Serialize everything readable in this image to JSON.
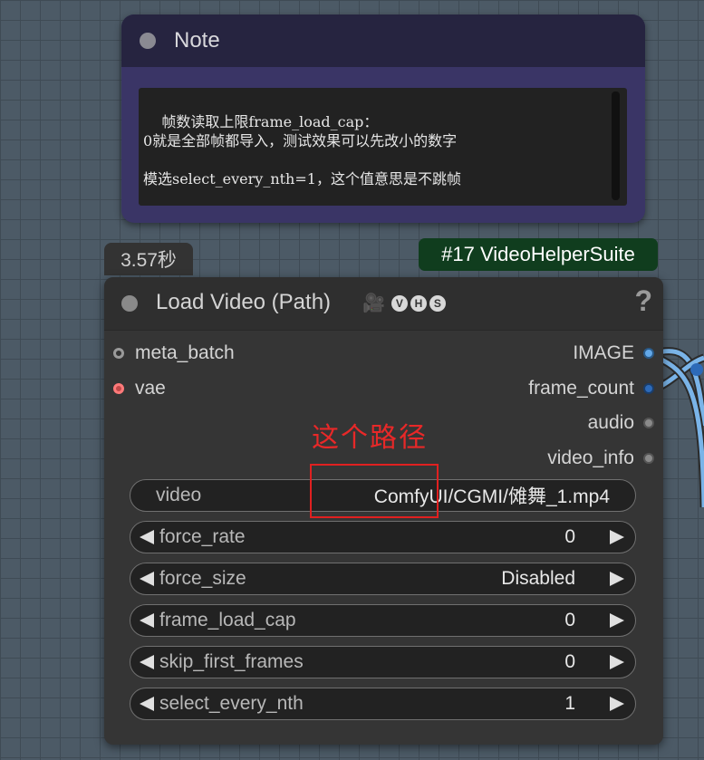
{
  "note": {
    "title": "Note",
    "text": "帧数读取上限frame_load_cap：\n0就是全部帧都导入，测试效果可以先改小的数字\n\n模选select_every_nth=1，这个值意思是不跳帧"
  },
  "timing": "3.57秒",
  "node_badge": "#17 VideoHelperSuite",
  "node": {
    "title": "Load Video (Path)",
    "badge_icon": "movie-camera-icon",
    "badge_letters": [
      "V",
      "H",
      "S"
    ],
    "help": "?",
    "inputs": [
      {
        "label": "meta_batch",
        "color": "#9a9a9a"
      },
      {
        "label": "vae",
        "color": "#ff7a7a"
      }
    ],
    "outputs": [
      {
        "label": "IMAGE",
        "color": "#63a8e8"
      },
      {
        "label": "frame_count",
        "color": "#2d6ab8"
      },
      {
        "label": "audio",
        "color": "#8a8a8a"
      },
      {
        "label": "video_info",
        "color": "#8a8a8a"
      }
    ],
    "widgets": {
      "video": {
        "label": "video",
        "value": "ComfyUI/CGMI/傩舞_1.mp4"
      },
      "force_rate": {
        "label": "force_rate",
        "value": "0"
      },
      "force_size": {
        "label": "force_size",
        "value": "Disabled"
      },
      "frame_load_cap": {
        "label": "frame_load_cap",
        "value": "0"
      },
      "skip_first_frames": {
        "label": "skip_first_frames",
        "value": "0"
      },
      "select_every_nth": {
        "label": "select_every_nth",
        "value": "1"
      }
    }
  },
  "annotation": {
    "text": "这个路径",
    "color": "#e82828"
  },
  "colors": {
    "canvas": "#4c5a66",
    "node_bg": "#353535",
    "note_bg": "#3a3566",
    "badge_bg": "#103d1e",
    "wire": "#7ab4e8"
  }
}
